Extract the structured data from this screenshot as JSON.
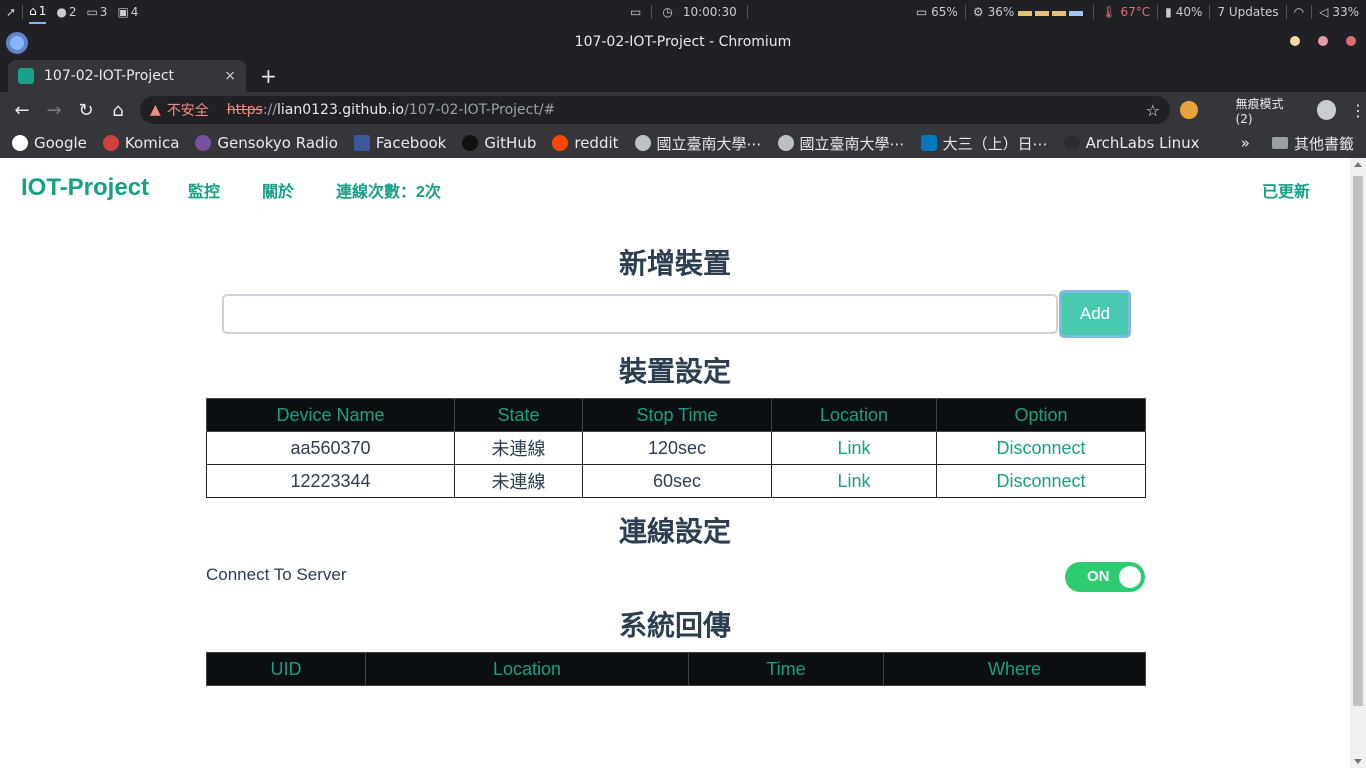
{
  "system_bar": {
    "workspaces": [
      "1",
      "2",
      "3",
      "4"
    ],
    "clock": "10:00:30",
    "battery": "65%",
    "cpu": "36%",
    "temperature": "67°C",
    "memory": "40%",
    "updates": "7 Updates",
    "volume": "33%"
  },
  "window": {
    "title": "107-02-IOT-Project - Chromium"
  },
  "tab": {
    "label": "107-02-IOT-Project",
    "close": "×",
    "new_tab": "+"
  },
  "address_bar": {
    "security_label": "不安全",
    "scheme": "https",
    "separator": "://",
    "host": "lian0123.github.io",
    "path": "/107-02-IOT-Project/#"
  },
  "toolbar": {
    "incognito_label": "無痕模式 (2)"
  },
  "bookmarks": {
    "items": [
      "Google",
      "Komica",
      "Gensokyo Radio",
      "Facebook",
      "GitHub",
      "reddit",
      "國立臺南大學⋯",
      "國立臺南大學⋯",
      "大三（上）日⋯",
      "ArchLabs Linux"
    ],
    "more": "»",
    "other": "其他書籤"
  },
  "nav": {
    "brand": "IOT-Project",
    "monitor": "監控",
    "about": "關於",
    "connections": "連線次數：2次",
    "updated": "已更新"
  },
  "add_device": {
    "heading": "新增裝置",
    "input_value": "",
    "button": "Add"
  },
  "device_settings": {
    "heading": "裝置設定",
    "columns": [
      "Device Name",
      "State",
      "Stop Time",
      "Location",
      "Option"
    ],
    "rows": [
      {
        "name": "aa560370",
        "state": "未連線",
        "stop_time": "120sec",
        "location": "Link",
        "option": "Disconnect"
      },
      {
        "name": "12223344",
        "state": "未連線",
        "stop_time": "60sec",
        "location": "Link",
        "option": "Disconnect"
      }
    ]
  },
  "connection_settings": {
    "heading": "連線設定",
    "label": "Connect To Server",
    "toggle": "ON"
  },
  "system_return": {
    "heading": "系統回傳",
    "columns": [
      "UID",
      "Location",
      "Time",
      "Where"
    ]
  },
  "colors": {
    "accent": "#16a085",
    "button": "#48c9b0",
    "toggle_on": "#2ecc71",
    "heading": "#2c3e50",
    "table_header_bg": "#0b0f12"
  }
}
